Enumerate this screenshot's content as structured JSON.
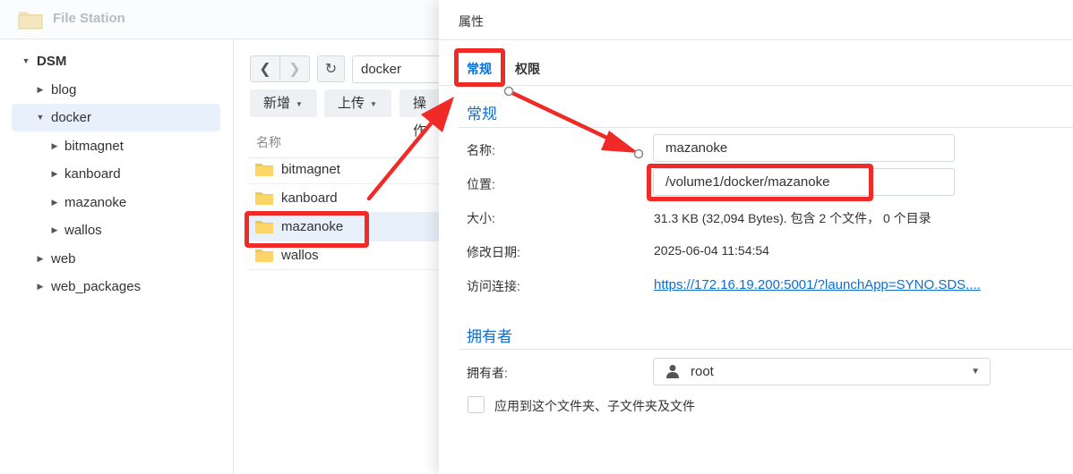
{
  "app": {
    "title": "File Station"
  },
  "sidebar": {
    "items": [
      {
        "label": "DSM",
        "expanded": true
      },
      {
        "label": "blog"
      },
      {
        "label": "docker",
        "expanded": true,
        "selected": true
      },
      {
        "label": "bitmagnet"
      },
      {
        "label": "kanboard"
      },
      {
        "label": "mazanoke"
      },
      {
        "label": "wallos"
      },
      {
        "label": "web"
      },
      {
        "label": "web_packages"
      }
    ]
  },
  "filelist": {
    "path": "docker",
    "toolbar": {
      "new_label": "新增",
      "upload_label": "上传",
      "action_label": "操作"
    },
    "column_name": "名称",
    "files": [
      {
        "name": "bitmagnet"
      },
      {
        "name": "kanboard"
      },
      {
        "name": "mazanoke",
        "selected": true
      },
      {
        "name": "wallos"
      }
    ]
  },
  "properties": {
    "title": "属性",
    "tabs": [
      {
        "label": "常规",
        "active": true
      },
      {
        "label": "权限"
      }
    ],
    "general_section": "常规",
    "name_label": "名称:",
    "name_value": "mazanoke",
    "location_label": "位置:",
    "location_value": "/volume1/docker/mazanoke",
    "size_label": "大小:",
    "size_value": "31.3 KB (32,094 Bytes). 包含 2 个文件， 0 个目录",
    "modified_label": "修改日期:",
    "modified_value": "2025-06-04 11:54:54",
    "link_label": "访问连接:",
    "link_value": "https://172.16.19.200:5001/?launchApp=SYNO.SDS....",
    "owner_section": "拥有者",
    "owner_label": "拥有者:",
    "owner_value": "root",
    "apply_checkbox_label": "应用到这个文件夹、子文件夹及文件",
    "apply_checked": false
  },
  "colors": {
    "accent": "#0b6fd6",
    "annotation_red": "#f02a26",
    "selected_bg": "#e8f1fb",
    "folder_yellow": "#f8c64a"
  }
}
